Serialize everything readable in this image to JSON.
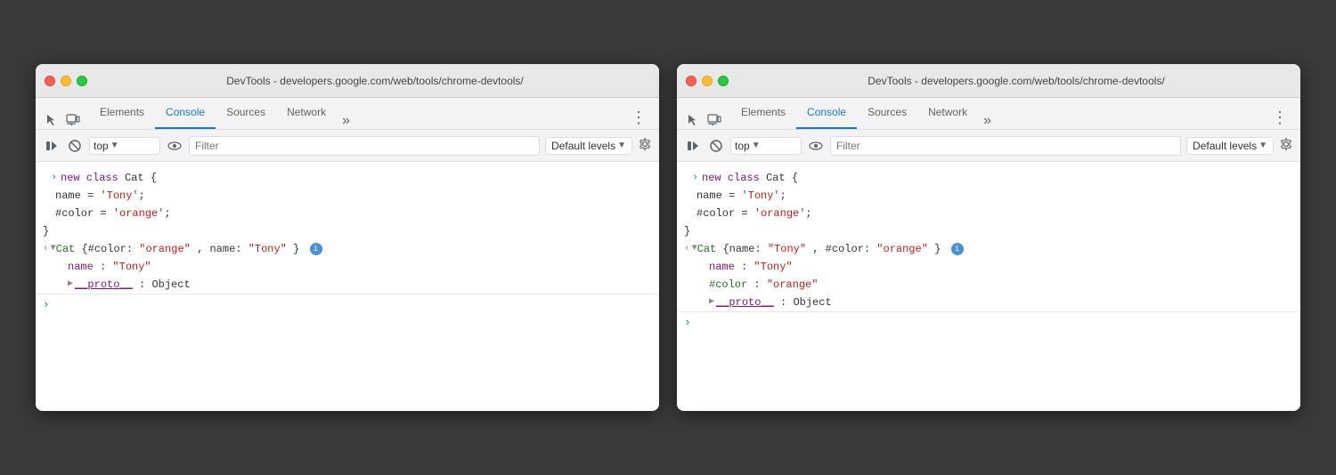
{
  "windows": [
    {
      "id": "left",
      "titleBar": {
        "text": "DevTools - developers.google.com/web/tools/chrome-devtools/"
      },
      "tabs": {
        "items": [
          "Elements",
          "Console",
          "Sources",
          "Network"
        ],
        "active": "Console",
        "more": "»"
      },
      "toolbar": {
        "topLabel": "top",
        "filterPlaceholder": "Filter",
        "defaultLevelsLabel": "Default levels"
      },
      "console": {
        "lines": [
          {
            "type": "input",
            "arrow": ">",
            "content": "new class Cat {"
          },
          {
            "type": "continuation",
            "content": "   name = 'Tony';"
          },
          {
            "type": "continuation",
            "content": "   #color = 'orange';"
          },
          {
            "type": "continuation",
            "content": "}"
          },
          {
            "type": "output-collapsed",
            "leftArrow": "<",
            "expandArrow": "▼",
            "objectLabel": "Cat {#color: ",
            "color1": "\"orange\"",
            "mid": ", name: ",
            "name1": "\"Tony\"",
            "end": "}",
            "hasInfo": true
          },
          {
            "type": "output-prop",
            "indent": 2,
            "key": "name",
            "colon": ": ",
            "value": "\"Tony\""
          },
          {
            "type": "output-proto",
            "indent": 2,
            "expandArrow": "▶",
            "protoKey": "__proto__",
            "colon": ": ",
            "protoValue": "Object"
          }
        ]
      }
    },
    {
      "id": "right",
      "titleBar": {
        "text": "DevTools - developers.google.com/web/tools/chrome-devtools/"
      },
      "tabs": {
        "items": [
          "Elements",
          "Console",
          "Sources",
          "Network"
        ],
        "active": "Console",
        "more": "»"
      },
      "toolbar": {
        "topLabel": "top",
        "filterPlaceholder": "Filter",
        "defaultLevelsLabel": "Default levels"
      },
      "console": {
        "lines": [
          {
            "type": "input",
            "arrow": ">",
            "content": "new class Cat {"
          },
          {
            "type": "continuation",
            "content": "   name = 'Tony';"
          },
          {
            "type": "continuation",
            "content": "   #color = 'orange';"
          },
          {
            "type": "continuation",
            "content": "}"
          },
          {
            "type": "output-collapsed",
            "leftArrow": "<",
            "expandArrow": "▼",
            "objectLabel": "Cat {name: ",
            "name1": "\"Tony\"",
            "mid": ", #color: ",
            "color1": "\"orange\"",
            "end": "}",
            "hasInfo": true
          },
          {
            "type": "output-prop",
            "indent": 2,
            "key": "name",
            "colon": ": ",
            "value": "\"Tony\""
          },
          {
            "type": "output-private",
            "indent": 2,
            "key": "#color",
            "colon": ": ",
            "value": "\"orange\""
          },
          {
            "type": "output-proto",
            "indent": 2,
            "expandArrow": "▶",
            "protoKey": "__proto__",
            "colon": ": ",
            "protoValue": "Object"
          }
        ]
      }
    }
  ],
  "labels": {
    "elements": "Elements",
    "console": "Console",
    "sources_left": "Sources",
    "sources_right": "Sources",
    "network_left": "Network",
    "network_right": "Network",
    "more": "»",
    "top_left": "top",
    "top_right": "top",
    "filter": "Filter",
    "defaultLevels": "Default levels"
  }
}
